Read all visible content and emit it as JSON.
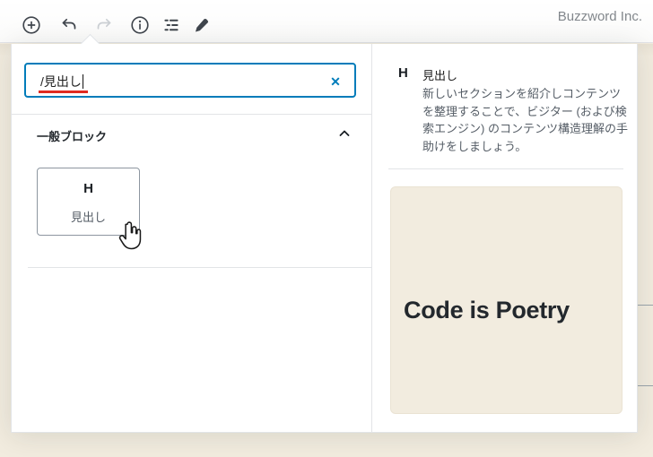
{
  "toolbar": {
    "company": "Buzzword Inc.",
    "icons": [
      {
        "name": "add-block",
        "glyph": "plus-circle",
        "disabled": false
      },
      {
        "name": "undo",
        "glyph": "undo-arrow",
        "disabled": false
      },
      {
        "name": "redo",
        "glyph": "redo-arrow",
        "disabled": true
      },
      {
        "name": "content-structure",
        "glyph": "info-circle",
        "disabled": false
      },
      {
        "name": "block-navigation",
        "glyph": "list-outline",
        "disabled": false
      },
      {
        "name": "edit-mode",
        "glyph": "pencil",
        "disabled": false
      }
    ]
  },
  "inserter": {
    "search_value": "/見出し",
    "clear_glyph": "✕",
    "section_title": "一般ブロック",
    "blocks": [
      {
        "icon": "H",
        "label": "見出し"
      }
    ],
    "details": {
      "icon": "H",
      "title": "見出し",
      "description": "新しいセクションを紹介しコンテンツを整理することで、ビジター (および検索エンジン) のコンテンツ構造理解の手助けをしましょう。"
    },
    "preview_text": "Code is Poetry"
  },
  "colors": {
    "accent_blue": "#007cba",
    "canvas_beige": "#f2ecdf",
    "spellcheck_red": "#e02b20",
    "icon_dark": "#40464d",
    "icon_disabled": "#ccd0d4"
  }
}
